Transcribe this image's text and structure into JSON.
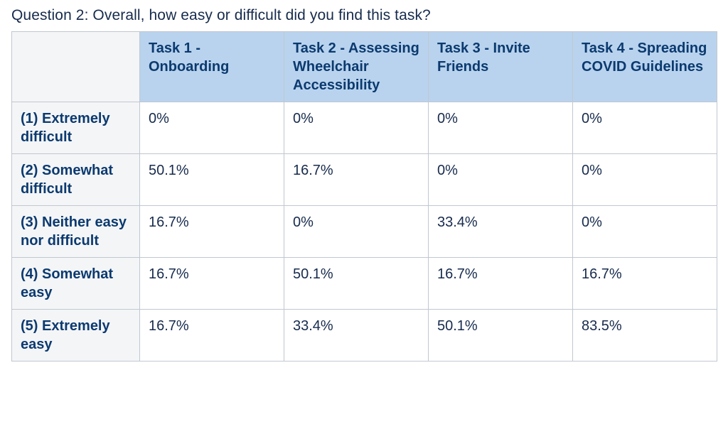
{
  "title": "Question 2: Overall, how easy or difficult did you find this task?",
  "columns": [
    "Task 1 - Onboarding",
    "Task 2 - Assessing Wheelchair Accessibility",
    "Task 3 - Invite Friends",
    "Task 4 - Spreading COVID Guidelines"
  ],
  "rows": [
    {
      "label": "(1) Extremely difficult",
      "cells": [
        "0%",
        "0%",
        "0%",
        "0%"
      ]
    },
    {
      "label": "(2) Somewhat difficult",
      "cells": [
        "50.1%",
        "16.7%",
        "0%",
        "0%"
      ]
    },
    {
      "label": "(3) Neither easy nor difficult",
      "cells": [
        "16.7%",
        "0%",
        "33.4%",
        "0%"
      ]
    },
    {
      "label": "(4) Somewhat easy",
      "cells": [
        "16.7%",
        "50.1%",
        "16.7%",
        "16.7%"
      ]
    },
    {
      "label": "(5) Extremely easy",
      "cells": [
        "16.7%",
        "33.4%",
        "50.1%",
        "83.5%"
      ]
    }
  ],
  "chart_data": {
    "type": "table",
    "title": "Question 2: Overall, how easy or difficult did you find this task?",
    "categories": [
      "(1) Extremely difficult",
      "(2) Somewhat difficult",
      "(3) Neither easy nor difficult",
      "(4) Somewhat easy",
      "(5) Extremely easy"
    ],
    "series": [
      {
        "name": "Task 1 - Onboarding",
        "values": [
          0,
          50.1,
          16.7,
          16.7,
          16.7
        ]
      },
      {
        "name": "Task 2 - Assessing Wheelchair Accessibility",
        "values": [
          0,
          16.7,
          0,
          50.1,
          33.4
        ]
      },
      {
        "name": "Task 3 - Invite Friends",
        "values": [
          0,
          0,
          33.4,
          16.7,
          50.1
        ]
      },
      {
        "name": "Task 4 - Spreading COVID Guidelines",
        "values": [
          0,
          0,
          0,
          16.7,
          83.5
        ]
      }
    ],
    "xlabel": "",
    "ylabel": "",
    "ylim": [
      0,
      100
    ]
  }
}
